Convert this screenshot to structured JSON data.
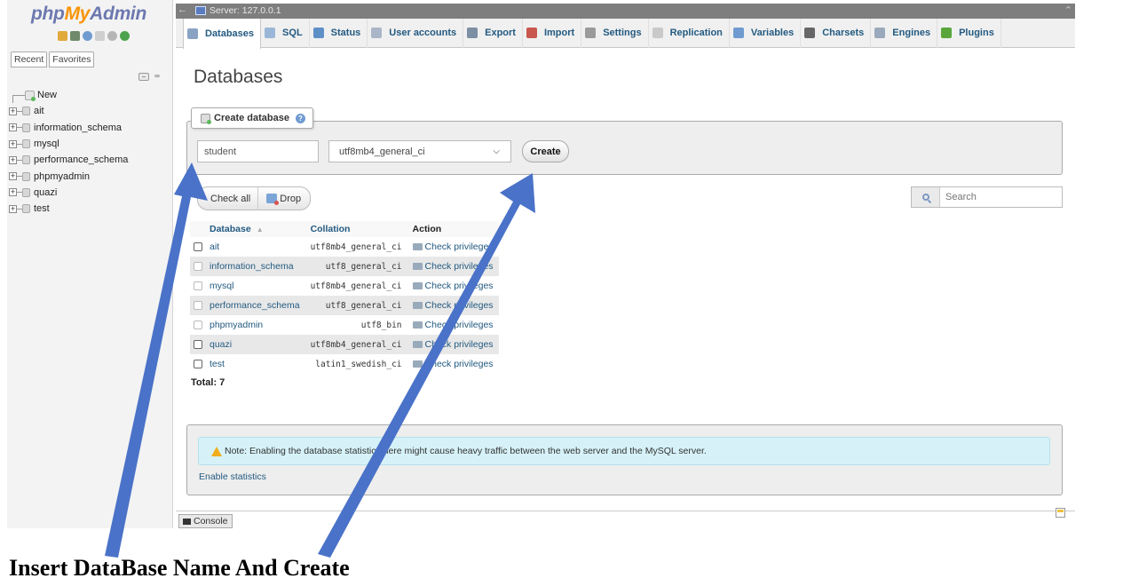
{
  "nav": {
    "logo": {
      "php": "php",
      "my": "My",
      "admin": "Admin"
    },
    "tabs": [
      "Recent",
      "Favorites"
    ],
    "tree": [
      {
        "label": "New"
      },
      {
        "label": "ait"
      },
      {
        "label": "information_schema"
      },
      {
        "label": "mysql"
      },
      {
        "label": "performance_schema"
      },
      {
        "label": "phpmyadmin"
      },
      {
        "label": "quazi"
      },
      {
        "label": "test"
      }
    ]
  },
  "serverbar": {
    "label": "Server: 127.0.0.1"
  },
  "menu": {
    "tabs": [
      {
        "label": "Databases",
        "icon": "database-icon",
        "color": "#8aa3c2",
        "active": true
      },
      {
        "label": "SQL",
        "icon": "sql-icon",
        "color": "#9bb7d8"
      },
      {
        "label": "Status",
        "icon": "status-icon",
        "color": "#5f8fc7"
      },
      {
        "label": "User accounts",
        "icon": "user-accounts-icon",
        "color": "#aab6c8"
      },
      {
        "label": "Export",
        "icon": "export-icon",
        "color": "#7c8fa3"
      },
      {
        "label": "Import",
        "icon": "import-icon",
        "color": "#c9574e"
      },
      {
        "label": "Settings",
        "icon": "settings-icon",
        "color": "#9a9a9a"
      },
      {
        "label": "Replication",
        "icon": "replication-icon",
        "color": "#c9c9c9"
      },
      {
        "label": "Variables",
        "icon": "variables-icon",
        "color": "#6f9bd1"
      },
      {
        "label": "Charsets",
        "icon": "charsets-icon",
        "color": "#666666"
      },
      {
        "label": "Engines",
        "icon": "engines-icon",
        "color": "#9aa9bb"
      },
      {
        "label": "Plugins",
        "icon": "plugins-icon",
        "color": "#5aa63c"
      }
    ]
  },
  "main": {
    "title": "Databases",
    "create": {
      "legend": "Create database",
      "name_value": "student",
      "collation_value": "utf8mb4_general_ci",
      "button": "Create"
    },
    "check_all": "Check all",
    "drop": "Drop",
    "search_placeholder": "Search",
    "table": {
      "headers": {
        "database": "Database",
        "collation": "Collation",
        "action": "Action"
      },
      "rows": [
        {
          "name": "ait",
          "collation": "utf8mb4_general_ci",
          "action": "Check privileges"
        },
        {
          "name": "information_schema",
          "collation": "utf8_general_ci",
          "action": "Check privileges"
        },
        {
          "name": "mysql",
          "collation": "utf8mb4_general_ci",
          "action": "Check privileges"
        },
        {
          "name": "performance_schema",
          "collation": "utf8_general_ci",
          "action": "Check privileges"
        },
        {
          "name": "phpmyadmin",
          "collation": "utf8_bin",
          "action": "Check privileges"
        },
        {
          "name": "quazi",
          "collation": "utf8mb4_general_ci",
          "action": "Check privileges"
        },
        {
          "name": "test",
          "collation": "latin1_swedish_ci",
          "action": "Check privileges"
        }
      ]
    },
    "total": "Total: 7",
    "notice": "Note: Enabling the database statistics here might cause heavy traffic between the web server and the MySQL server.",
    "enable_stats": "Enable statistics"
  },
  "console": {
    "label": "Console"
  },
  "caption": "Insert DataBase Name And Create",
  "colors": {
    "arrow": "#4a72c8",
    "link": "#235a81",
    "notice_bg": "#d6f2f8"
  }
}
